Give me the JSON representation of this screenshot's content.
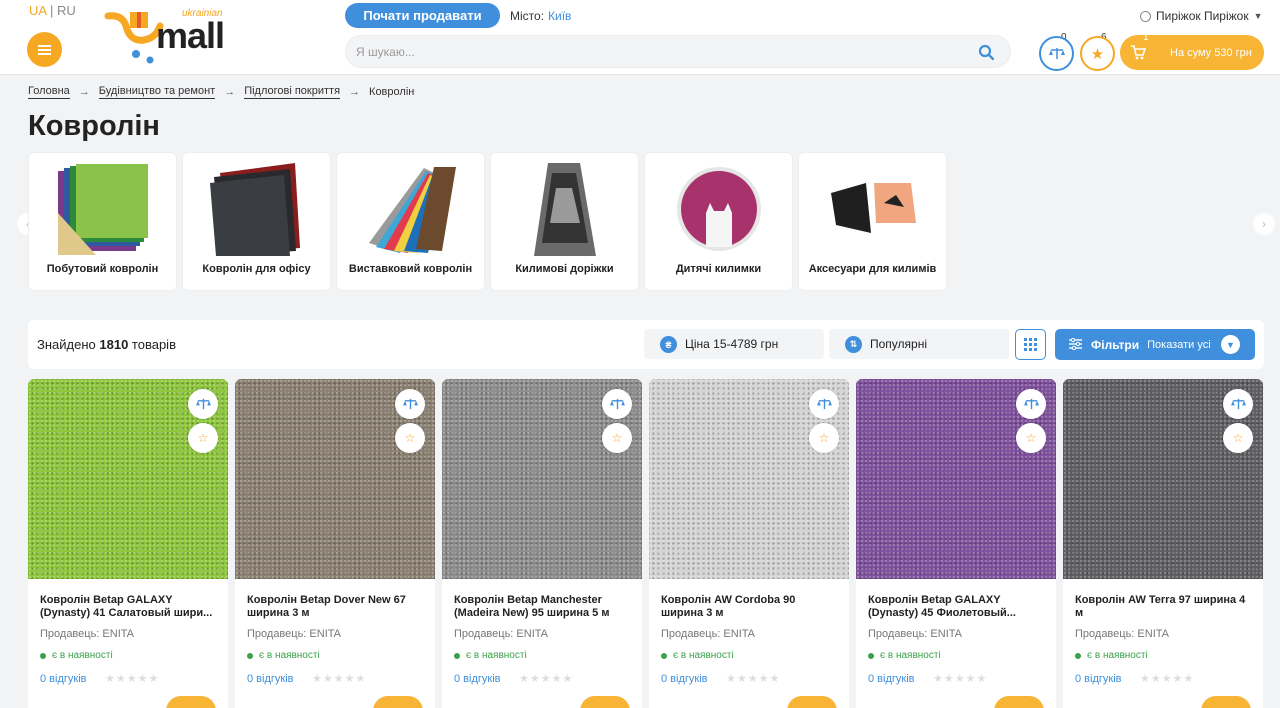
{
  "header": {
    "lang_ua": "UA",
    "lang_sep": "|",
    "lang_ru": "RU",
    "logo_text": "mall",
    "logo_sub": "ukrainian",
    "sell_button": "Почати продавати",
    "city_label": "Місто:",
    "city_value": "Київ",
    "search_placeholder": "Я шукаю...",
    "user_name": "Пиріжок Пиріжок",
    "compare_count": "0",
    "favorites_count": "6",
    "cart_count": "1",
    "cart_label": "На суму 530 грн"
  },
  "breadcrumb": {
    "items": [
      "Головна",
      "Будівництво та ремонт",
      "Підлогові покриття"
    ],
    "current": "Ковролін"
  },
  "page_title": "Ковролін",
  "categories": [
    {
      "label": "Побутовий ковролін"
    },
    {
      "label": "Ковролін для офісу"
    },
    {
      "label": "Виставковий ковролін"
    },
    {
      "label": "Килимові доріжки"
    },
    {
      "label": "Дитячі килимки"
    },
    {
      "label": "Аксесуари для килимів"
    }
  ],
  "toolbar": {
    "found_prefix": "Знайдено",
    "found_count": "1810",
    "found_suffix": "товарів",
    "price_filter": "Ціна 15-4789 грн",
    "sort": "Популярні",
    "filters_label": "Фільтри",
    "filters_sub": "Показати усі"
  },
  "products": [
    {
      "title": "Ковролін Betap GALAXY (Dynasty) 41 Салатовый шири...",
      "seller": "Продавець: ENITA",
      "stock": "є в наявності",
      "reviews": "0 відгуків",
      "color": "#8cc63a"
    },
    {
      "title": "Ковролін Betap Dover New 67 ширина 3 м",
      "seller": "Продавець: ENITA",
      "stock": "є в наявності",
      "reviews": "0 відгуків",
      "color": "#8a7f70"
    },
    {
      "title": "Ковролін Betap Manchester (Madeira New) 95 ширина 5 м",
      "seller": "Продавець: ENITA",
      "stock": "є в наявності",
      "reviews": "0 відгуків",
      "color": "#8c8c8c"
    },
    {
      "title": "Ковролін AW Cordoba 90 ширина 3 м",
      "seller": "Продавець: ENITA",
      "stock": "є в наявності",
      "reviews": "0 відгуків",
      "color": "#d4d4d4"
    },
    {
      "title": "Ковролін Betap GALAXY (Dynasty) 45 Фиолетовый...",
      "seller": "Продавець: ENITA",
      "stock": "є в наявності",
      "reviews": "0 відгуків",
      "color": "#7e4f9c"
    },
    {
      "title": "Ковролін AW Terra 97 ширина 4 м",
      "seller": "Продавець: ENITA",
      "stock": "є в наявності",
      "reviews": "0 відгуків",
      "color": "#5e5e62"
    }
  ],
  "colors": {
    "accent": "#f7a823",
    "primary": "#3f8fdc",
    "in_stock": "#3aa14a"
  }
}
